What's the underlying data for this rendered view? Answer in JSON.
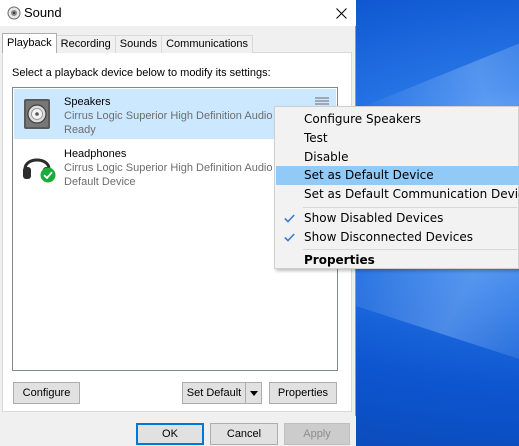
{
  "window": {
    "title": "Sound",
    "icon": "speaker-icon",
    "close_icon": "close-icon"
  },
  "tabs": [
    {
      "label": "Playback",
      "active": true
    },
    {
      "label": "Recording",
      "active": false
    },
    {
      "label": "Sounds",
      "active": false
    },
    {
      "label": "Communications",
      "active": false
    }
  ],
  "playback": {
    "instructions": "Select a playback device below to modify its settings:",
    "devices": [
      {
        "name": "Speakers",
        "description": "Cirrus Logic Superior High Definition Audio",
        "status": "Ready",
        "icon": "speaker-device-icon",
        "selected": true
      },
      {
        "name": "Headphones",
        "description": "Cirrus Logic Superior High Definition Audio",
        "status": "Default Device",
        "icon": "headphones-device-icon",
        "badge": "default-check-icon",
        "selected": false
      }
    ],
    "buttons": {
      "configure": "Configure",
      "set_default": "Set Default",
      "properties": "Properties"
    }
  },
  "footer": {
    "ok": "OK",
    "cancel": "Cancel",
    "apply": "Apply",
    "apply_enabled": false
  },
  "context_menu": {
    "items": [
      {
        "label": "Configure Speakers"
      },
      {
        "label": "Test"
      },
      {
        "label": "Disable"
      },
      {
        "label": "Set as Default Device",
        "highlighted": true
      },
      {
        "label": "Set as Default Communication Device"
      },
      {
        "label": "Show Disabled Devices",
        "checked": true
      },
      {
        "label": "Show Disconnected Devices",
        "checked": true
      },
      {
        "label": "Properties",
        "bold": true
      }
    ]
  },
  "colors": {
    "selection": "#cce8ff",
    "menu_highlight": "#91c9f7",
    "accent": "#0078d7",
    "check": "#3a7fd5",
    "default_badge": "#1aab3a"
  }
}
